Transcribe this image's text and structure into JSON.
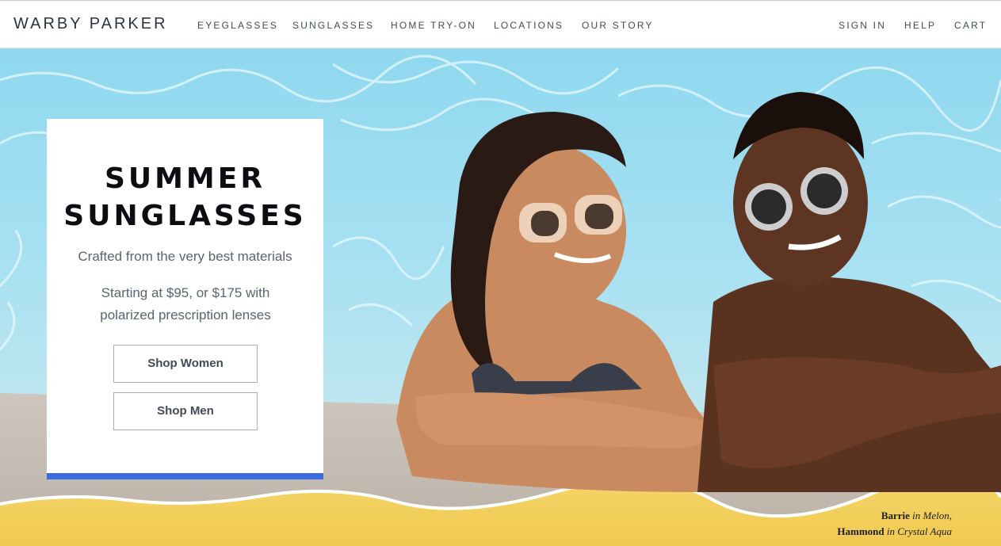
{
  "nav": {
    "logo": "WARBY PARKER",
    "left_links": [
      "EYEGLASSES",
      "SUNGLASSES",
      "HOME TRY-ON",
      "LOCATIONS",
      "OUR STORY"
    ],
    "right_links": [
      "SIGN IN",
      "HELP",
      "CART"
    ]
  },
  "promo": {
    "headline_line1": "SUMMER",
    "headline_line2": "SUNGLASSES",
    "subtitle": "Crafted from the very best materials",
    "price_text": "Starting at $95, or $175 with polarized prescription lenses",
    "shop_women_label": "Shop Women",
    "shop_men_label": "Shop Men",
    "accent_color": "#3b6be0"
  },
  "caption": {
    "frame1_name": "Barrie",
    "frame1_color": " in Melon,",
    "frame2_name": "Hammond",
    "frame2_color": " in Crystal Aqua"
  }
}
